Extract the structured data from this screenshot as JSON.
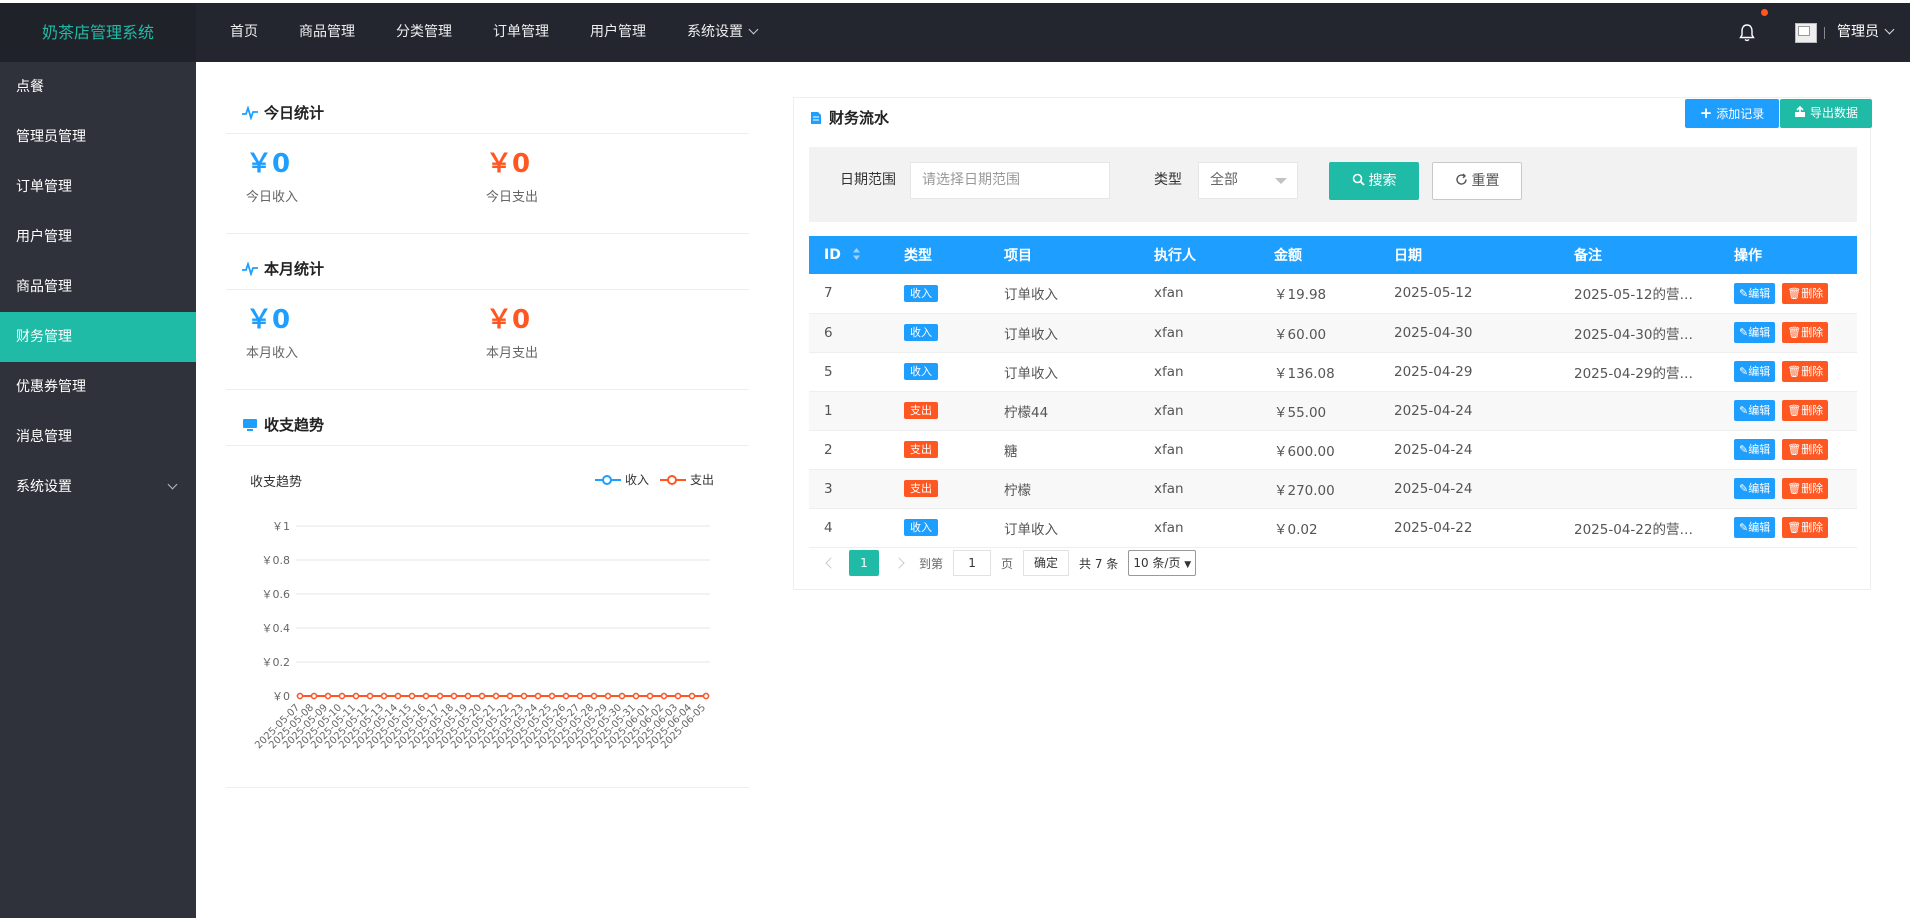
{
  "app": {
    "title": "奶茶店管理系统"
  },
  "topnav": {
    "items": [
      "首页",
      "商品管理",
      "分类管理",
      "订单管理",
      "用户管理",
      "系统设置"
    ],
    "user": "管理员"
  },
  "sidebar": {
    "items": [
      "点餐",
      "管理员管理",
      "订单管理",
      "用户管理",
      "商品管理",
      "财务管理",
      "优惠券管理",
      "消息管理",
      "系统设置"
    ],
    "active": "财务管理"
  },
  "today": {
    "title": "今日统计",
    "income_value": "￥0",
    "income_label": "今日收入",
    "expense_value": "￥0",
    "expense_label": "今日支出"
  },
  "month": {
    "title": "本月统计",
    "income_value": "￥0",
    "income_label": "本月收入",
    "expense_value": "￥0",
    "expense_label": "本月支出"
  },
  "trend": {
    "title": "收支趋势"
  },
  "colors": {
    "accent": "#1fbba6",
    "income": "#1e9fff",
    "expense": "#ff5722",
    "topbar": "#23262e",
    "sidebar": "#2f323a"
  },
  "chart_data": {
    "type": "line",
    "title": "收支趋势",
    "x": [
      "2025-05-07",
      "2025-05-08",
      "2025-05-09",
      "2025-05-10",
      "2025-05-11",
      "2025-05-12",
      "2025-05-13",
      "2025-05-14",
      "2025-05-15",
      "2025-05-16",
      "2025-05-17",
      "2025-05-18",
      "2025-05-19",
      "2025-05-20",
      "2025-05-21",
      "2025-05-22",
      "2025-05-23",
      "2025-05-24",
      "2025-05-25",
      "2025-05-26",
      "2025-05-27",
      "2025-05-28",
      "2025-05-29",
      "2025-05-30",
      "2025-05-31",
      "2025-06-01",
      "2025-06-02",
      "2025-06-03",
      "2025-06-04",
      "2025-06-05"
    ],
    "series": [
      {
        "name": "收入",
        "color": "#1e9fff",
        "values": [
          0,
          0,
          0,
          0,
          0,
          0,
          0,
          0,
          0,
          0,
          0,
          0,
          0,
          0,
          0,
          0,
          0,
          0,
          0,
          0,
          0,
          0,
          0,
          0,
          0,
          0,
          0,
          0,
          0,
          0
        ]
      },
      {
        "name": "支出",
        "color": "#ff5722",
        "values": [
          0,
          0,
          0,
          0,
          0,
          0,
          0,
          0,
          0,
          0,
          0,
          0,
          0,
          0,
          0,
          0,
          0,
          0,
          0,
          0,
          0,
          0,
          0,
          0,
          0,
          0,
          0,
          0,
          0,
          0
        ]
      }
    ],
    "yticks": [
      "￥0",
      "￥0.2",
      "￥0.4",
      "￥0.6",
      "￥0.8",
      "￥1"
    ],
    "ylim": [
      0,
      1
    ],
    "grid": true,
    "legend": "top-right"
  },
  "finance": {
    "title": "财务流水",
    "add_label": "添加记录",
    "export_label": "导出数据",
    "filter": {
      "date_label": "日期范围",
      "date_placeholder": "请选择日期范围",
      "type_label": "类型",
      "type_value": "全部",
      "search_label": "搜索",
      "reset_label": "重置"
    },
    "columns": [
      "ID",
      "类型",
      "项目",
      "执行人",
      "金额",
      "日期",
      "备注",
      "操作"
    ],
    "edit_label": "编辑",
    "delete_label": "删除",
    "rows": [
      {
        "id": "7",
        "type": "收入",
        "kind": "in",
        "item": "订单收入",
        "operator": "xfan",
        "amount": "￥19.98",
        "date": "2025-05-12",
        "note": "2025-05-12的营业..."
      },
      {
        "id": "6",
        "type": "收入",
        "kind": "in",
        "item": "订单收入",
        "operator": "xfan",
        "amount": "￥60.00",
        "date": "2025-04-30",
        "note": "2025-04-30的营业..."
      },
      {
        "id": "5",
        "type": "收入",
        "kind": "in",
        "item": "订单收入",
        "operator": "xfan",
        "amount": "￥136.08",
        "date": "2025-04-29",
        "note": "2025-04-29的营业..."
      },
      {
        "id": "1",
        "type": "支出",
        "kind": "out",
        "item": "柠檬44",
        "operator": "xfan",
        "amount": "￥55.00",
        "date": "2025-04-24",
        "note": ""
      },
      {
        "id": "2",
        "type": "支出",
        "kind": "out",
        "item": "糖",
        "operator": "xfan",
        "amount": "￥600.00",
        "date": "2025-04-24",
        "note": ""
      },
      {
        "id": "3",
        "type": "支出",
        "kind": "out",
        "item": "柠檬",
        "operator": "xfan",
        "amount": "￥270.00",
        "date": "2025-04-24",
        "note": ""
      },
      {
        "id": "4",
        "type": "收入",
        "kind": "in",
        "item": "订单收入",
        "operator": "xfan",
        "amount": "￥0.02",
        "date": "2025-04-22",
        "note": "2025-04-22的营业..."
      }
    ],
    "pager": {
      "current": "1",
      "goto_label": "到第",
      "goto_value": "1",
      "page_unit": "页",
      "confirm_label": "确定",
      "total": "共 7 条",
      "page_size": "10 条/页"
    }
  }
}
